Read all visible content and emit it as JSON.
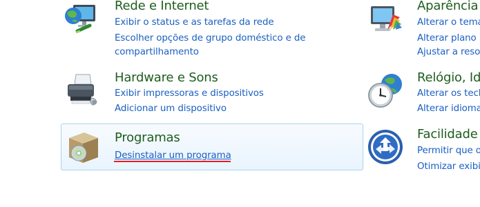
{
  "categories": [
    {
      "title": "Rede e Internet",
      "links": [
        "Exibir o status e as tarefas da rede",
        "Escolher opções de grupo doméstico e de",
        "compartilhamento"
      ],
      "icon": "network-globe-icon"
    },
    {
      "title": "Aparência",
      "links": [
        "Alterar o tema",
        "Alterar plano",
        "Ajustar a resol"
      ],
      "icon": "appearance-monitor-icon"
    },
    {
      "title": "Hardware e Sons",
      "links": [
        "Exibir impressoras e dispositivos",
        "Adicionar um dispositivo"
      ],
      "icon": "printer-icon"
    },
    {
      "title": "Relógio, Id",
      "links": [
        "Alterar os tecl",
        "Alterar idioma"
      ],
      "icon": "clock-globe-icon"
    },
    {
      "title": "Programas",
      "links": [
        "Desinstalar um programa"
      ],
      "icon": "programs-box-icon"
    },
    {
      "title": "Facilidade",
      "links": [
        "Permitir que o",
        "Otimizar exibi"
      ],
      "icon": "ease-of-access-icon"
    }
  ],
  "colors": {
    "title": "#1e5d1e",
    "link": "#1a5fc2",
    "highlight_border": "#a9d4ee",
    "annotation_underline": "#e51b27"
  }
}
